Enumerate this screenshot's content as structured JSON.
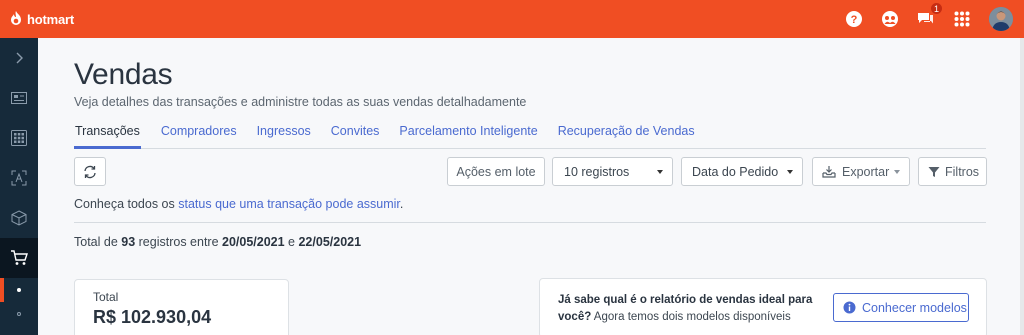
{
  "brand": {
    "name": "hotmart",
    "accent": "#f04e23",
    "link": "#4a6ad0",
    "sidebar": "#162a3a"
  },
  "topbar": {
    "icons": [
      "help-icon",
      "community-icon",
      "chat-icon",
      "apps-grid-icon",
      "avatar"
    ],
    "chat_badge": "1"
  },
  "sidebar": {
    "items": [
      "chevron-right-icon",
      "dashboard-icon",
      "grid-icon",
      "analytics-icon",
      "product-box-icon",
      "cart-icon"
    ]
  },
  "page": {
    "title": "Vendas",
    "subtitle": "Veja detalhes das transações e administre todas as suas vendas detalhadamente"
  },
  "tabs": [
    {
      "label": "Transações",
      "active": true
    },
    {
      "label": "Compradores"
    },
    {
      "label": "Ingressos"
    },
    {
      "label": "Convites"
    },
    {
      "label": "Parcelamento Inteligente"
    },
    {
      "label": "Recuperação de Vendas"
    }
  ],
  "toolbar": {
    "acoes_label": "Ações em lote",
    "registros_value": "10 registros",
    "date_value": "Data do Pedido",
    "export_label": "Exportar",
    "filtros_label": "Filtros"
  },
  "status_info": {
    "prefix": "Conheça todos os ",
    "link": "status que uma transação pode assumir",
    "suffix": "."
  },
  "summary": {
    "prefix": "Total de ",
    "count": "93",
    "middle": " registros entre ",
    "start": "20/05/2021",
    "and": " e ",
    "end": "22/05/2021"
  },
  "total_card": {
    "label": "Total",
    "value": "R$ 102.930,04"
  },
  "report_card": {
    "question": "Já sabe qual é o relatório de vendas ideal para você?",
    "text": " Agora temos dois modelos disponíveis",
    "button": "Conhecer modelos"
  }
}
